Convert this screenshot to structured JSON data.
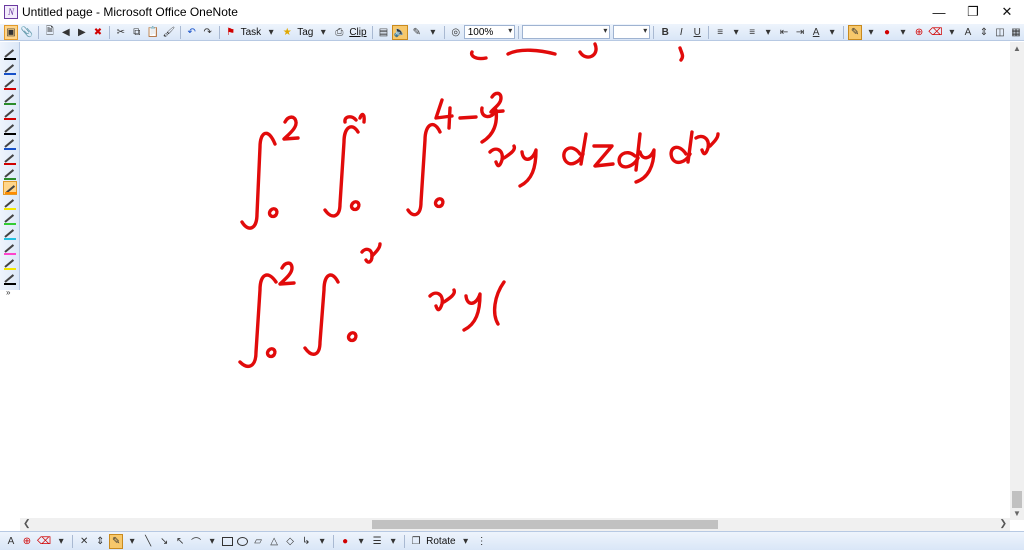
{
  "window": {
    "title": "Untitled page - Microsoft Office OneNote",
    "controls": [
      "minimize-icon",
      "restore-icon",
      "close-icon"
    ]
  },
  "toolbar": {
    "task_label": "Task",
    "tag_label": "Tag",
    "clip_label": "Clip",
    "zoom_value": "100%",
    "font_name_value": "",
    "font_size_value": "",
    "bold_label": "B",
    "italic_label": "I",
    "underline_label": "U",
    "accent_color": "#d10000"
  },
  "pen_palette": {
    "colors": [
      "#000000",
      "#1650c8",
      "#d10000",
      "#2a8c2a",
      "#d10000",
      "#000000",
      "#1650c8",
      "#d10000",
      "#2a8c2a",
      "#ff8c00",
      "#f2e600",
      "#33cc33",
      "#22c0e0",
      "#ff44cc",
      "#f2e600",
      "#000000"
    ],
    "selected_index": 9
  },
  "drawing_toolbar": {
    "rotate_label": "Rotate"
  },
  "ink": {
    "color": "#e10b0b"
  }
}
